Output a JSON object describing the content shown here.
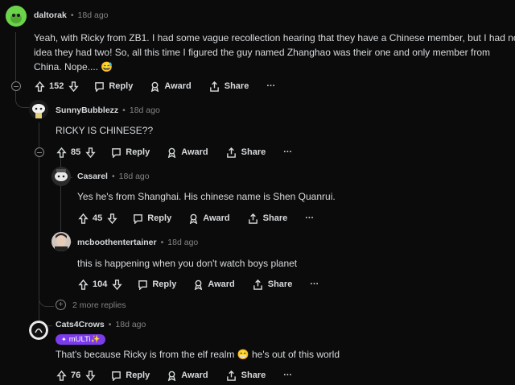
{
  "actions": {
    "reply": "Reply",
    "award": "Award",
    "share": "Share",
    "more": "···"
  },
  "comments": [
    {
      "user": "daltorak",
      "time": "18d ago",
      "lines": [
        "Yeah, with Ricky from ZB1. I had some vague recollection hearing that they have a Chinese member, but I had no",
        "idea they had two! So, all this time I figured the guy named Zhanghao was their one and only member from",
        "China. Nope.... 😅"
      ],
      "votes": "152"
    },
    {
      "user": "SunnyBubblezz",
      "time": "18d ago",
      "lines": [
        "RICKY IS CHINESE??"
      ],
      "votes": "85"
    },
    {
      "user": "Casarel",
      "time": "18d ago",
      "lines": [
        "Yes he's from Shanghai. His chinese name is Shen Quanrui."
      ],
      "votes": "45"
    },
    {
      "user": "mcboothentertainer",
      "time": "18d ago",
      "lines": [
        "this is happening when you don't watch boys planet"
      ],
      "votes": "104"
    },
    {
      "user": "Cats4Crows",
      "time": "18d ago",
      "flair": "mULTi✨",
      "lines": [
        "That's because Ricky is from the elf realm 😁 he's out of this world"
      ],
      "votes": "76"
    }
  ],
  "more_replies": "2 more replies",
  "separator": "•"
}
